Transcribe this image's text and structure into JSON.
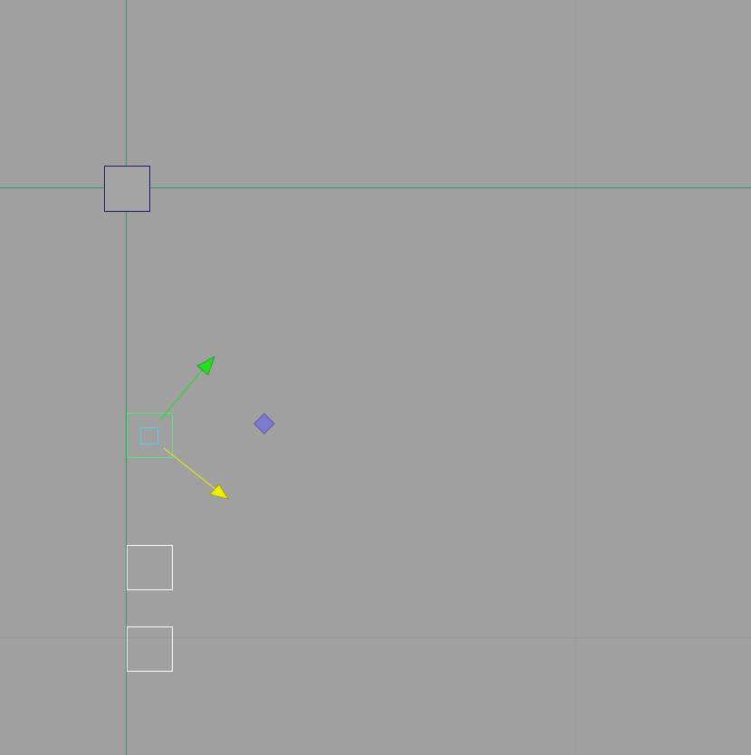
{
  "viewport": {
    "background_color": "#a0a0a0",
    "grid_line_color": "#989898",
    "axis_color": "#1f9a6a"
  },
  "objects": {
    "origin_marker": {
      "outline_color": "#1a1a6e",
      "fill_color": "#a4a4a4"
    },
    "selected_object": {
      "outline_color": "#5be08c",
      "inner_outline_color": "#4fd0e8"
    },
    "light_object": {
      "fill_color": "#7a7ccc",
      "outline_color": "#5a5caa"
    },
    "placeholder_box_1": {
      "outline_color": "#ffffff"
    },
    "placeholder_box_2": {
      "outline_color": "#ffffff"
    }
  },
  "gizmo": {
    "y_axis_color": "#22dd22",
    "x_axis_color": "#eeee00",
    "y_axis_icon": "arrow-up-right-icon",
    "x_axis_icon": "arrow-down-right-icon"
  }
}
